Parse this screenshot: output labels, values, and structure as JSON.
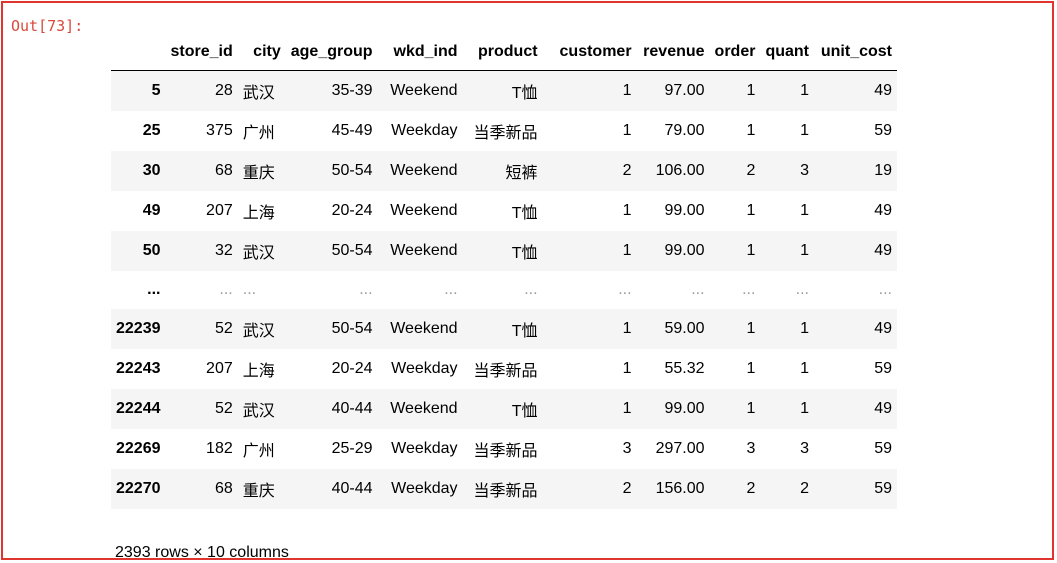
{
  "prompt": "Out[73]:",
  "table": {
    "columns": [
      "",
      "store_id",
      "city",
      "age_group",
      "wkd_ind",
      "product",
      "customer",
      "revenue",
      "order",
      "quant",
      "unit_cost"
    ],
    "rows": [
      [
        "5",
        "28",
        "武汉",
        "35-39",
        "Weekend",
        "T恤",
        "1",
        "97.00",
        "1",
        "1",
        "49"
      ],
      [
        "25",
        "375",
        "广州",
        "45-49",
        "Weekday",
        "当季新品",
        "1",
        "79.00",
        "1",
        "1",
        "59"
      ],
      [
        "30",
        "68",
        "重庆",
        "50-54",
        "Weekend",
        "短裤",
        "2",
        "106.00",
        "2",
        "3",
        "19"
      ],
      [
        "49",
        "207",
        "上海",
        "20-24",
        "Weekend",
        "T恤",
        "1",
        "99.00",
        "1",
        "1",
        "49"
      ],
      [
        "50",
        "32",
        "武汉",
        "50-54",
        "Weekend",
        "T恤",
        "1",
        "99.00",
        "1",
        "1",
        "49"
      ],
      [
        "...",
        "...",
        "...",
        "...",
        "...",
        "...",
        "...",
        "...",
        "...",
        "...",
        "..."
      ],
      [
        "22239",
        "52",
        "武汉",
        "50-54",
        "Weekend",
        "T恤",
        "1",
        "59.00",
        "1",
        "1",
        "49"
      ],
      [
        "22243",
        "207",
        "上海",
        "20-24",
        "Weekday",
        "当季新品",
        "1",
        "55.32",
        "1",
        "1",
        "59"
      ],
      [
        "22244",
        "52",
        "武汉",
        "40-44",
        "Weekend",
        "T恤",
        "1",
        "99.00",
        "1",
        "1",
        "49"
      ],
      [
        "22269",
        "182",
        "广州",
        "25-29",
        "Weekday",
        "当季新品",
        "3",
        "297.00",
        "3",
        "3",
        "59"
      ],
      [
        "22270",
        "68",
        "重庆",
        "40-44",
        "Weekday",
        "当季新品",
        "2",
        "156.00",
        "2",
        "2",
        "59"
      ]
    ]
  },
  "footer": "2393 rows × 10 columns",
  "colors": {
    "border": "#e0352f",
    "prompt": "#d84a3b",
    "stripe": "#f5f5f5"
  }
}
